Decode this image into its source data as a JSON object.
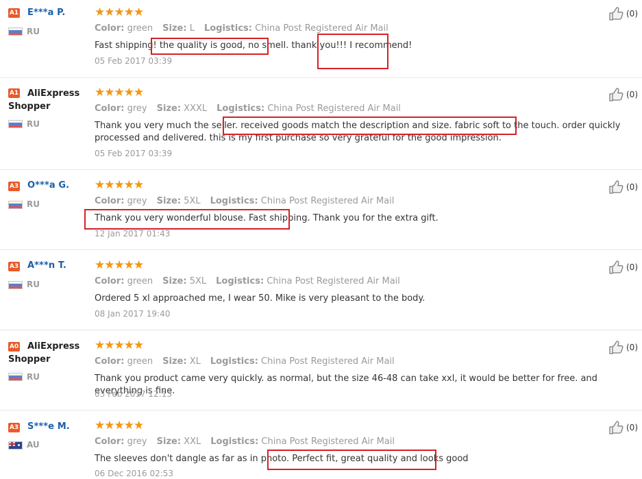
{
  "labels": {
    "color": "Color:",
    "size": "Size:",
    "logistics": "Logistics:"
  },
  "stars_glyph": "★★★★★",
  "colors": {
    "highlight": "#d42026",
    "star": "#f29712",
    "badge": "#e85a2a",
    "name": "#1a5fa8"
  },
  "reviews": [
    {
      "badge": "A1",
      "name": "E***a P.",
      "country": "RU",
      "color": "green",
      "size": "L",
      "logistics": "China Post Registered Air Mail",
      "text": "Fast shipping! the quality is good, no smell. thank you!!! I recommend!",
      "date": "05 Feb 2017 03:39",
      "likes": "(0)",
      "rating": 5
    },
    {
      "badge": "A1",
      "name_line1": "AliExpress",
      "name_line2": "Shopper",
      "country": "RU",
      "color": "grey",
      "size": "XXXL",
      "logistics": "China Post Registered Air Mail",
      "text": "Thank you very much the seller. received goods match the description and size. fabric soft to the touch. order quickly processed and delivered. this is my first purchase so very grateful for the good impression.",
      "date": "05 Feb 2017 03:39",
      "likes": "(0)",
      "rating": 5
    },
    {
      "badge": "A3",
      "name": "O***a G.",
      "country": "RU",
      "color": "grey",
      "size": "5XL",
      "logistics": "China Post Registered Air Mail",
      "text": "Thank you very wonderful blouse. Fast shipping. Thank you for the extra gift.",
      "date": "12 Jan 2017 01:43",
      "likes": "(0)",
      "rating": 5
    },
    {
      "badge": "A3",
      "name": "A***n T.",
      "country": "RU",
      "color": "green",
      "size": "5XL",
      "logistics": "China Post Registered Air Mail",
      "text": "Ordered 5 xl approached me, I wear 50. Mike is very pleasant to the body.",
      "date": "08 Jan 2017 19:40",
      "likes": "(0)",
      "rating": 5
    },
    {
      "badge": "A0",
      "name_line1": "AliExpress",
      "name_line2": "Shopper",
      "country": "RU",
      "color": "green",
      "size": "XL",
      "logistics": "China Post Registered Air Mail",
      "text": "Thank you product came very quickly. as normal, but the size 46-48 can take xxl, it would be better for free. and everything is fine.",
      "date": "03 Feb 2017 12:13",
      "likes": "(0)",
      "rating": 5
    },
    {
      "badge": "A3",
      "name": "S***e M.",
      "country": "AU",
      "color": "grey",
      "size": "XXL",
      "logistics": "China Post Registered Air Mail",
      "text": "The sleeves don't dangle as far as in photo. Perfect fit, great quality and looks good",
      "date": "06 Dec 2016 02:53",
      "likes": "(0)",
      "rating": 5
    }
  ]
}
